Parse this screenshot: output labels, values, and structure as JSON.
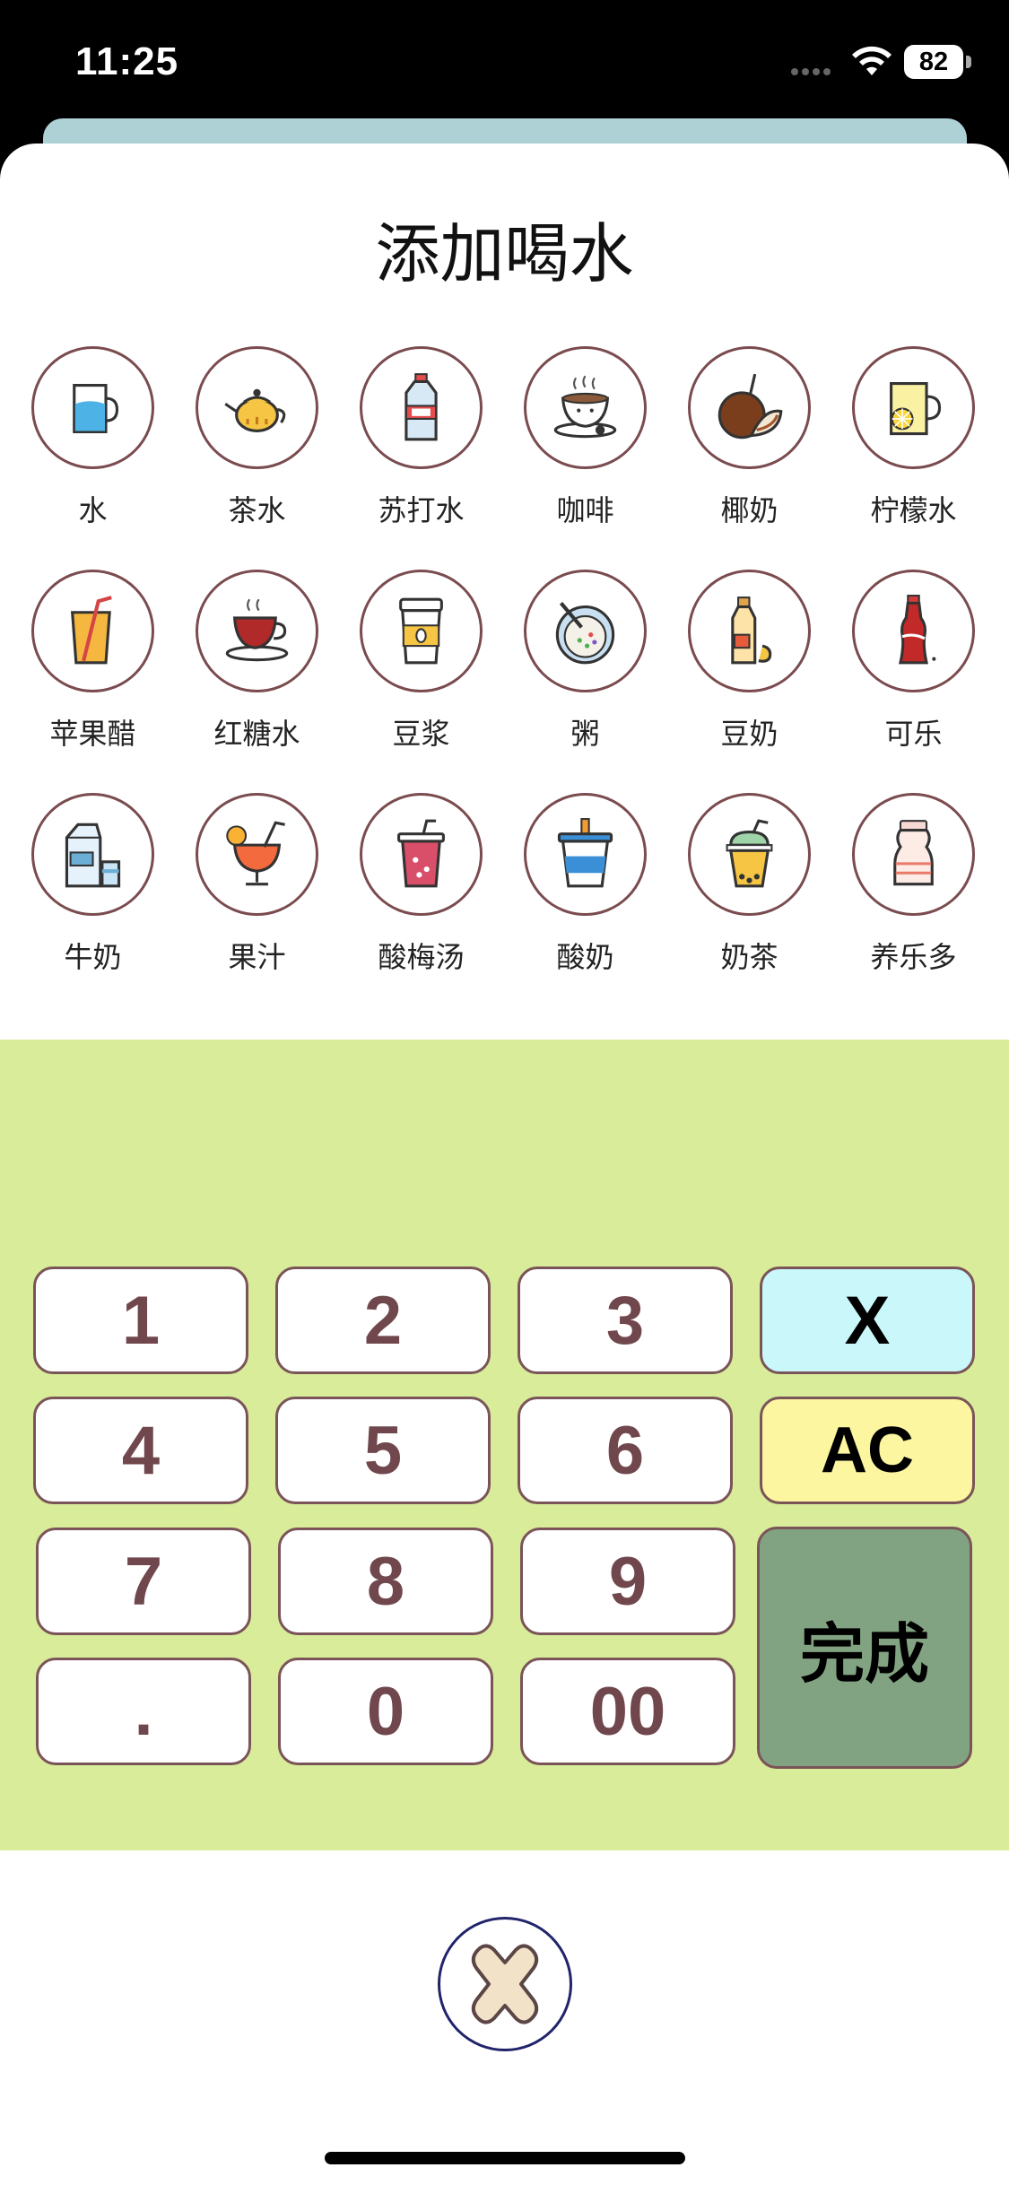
{
  "status_bar": {
    "time": "11:25",
    "battery": "82"
  },
  "sheet": {
    "title": "添加喝水"
  },
  "drinks": [
    {
      "label": "水",
      "icon": "water-glass-icon"
    },
    {
      "label": "茶水",
      "icon": "teapot-icon"
    },
    {
      "label": "苏打水",
      "icon": "soda-bottle-icon"
    },
    {
      "label": "咖啡",
      "icon": "coffee-cup-icon"
    },
    {
      "label": "椰奶",
      "icon": "coconut-icon"
    },
    {
      "label": "柠檬水",
      "icon": "lemonade-icon"
    },
    {
      "label": "苹果醋",
      "icon": "apple-vinegar-icon"
    },
    {
      "label": "红糖水",
      "icon": "brown-sugar-tea-icon"
    },
    {
      "label": "豆浆",
      "icon": "soy-milk-cup-icon"
    },
    {
      "label": "粥",
      "icon": "porridge-bowl-icon"
    },
    {
      "label": "豆奶",
      "icon": "soy-milk-bottle-icon"
    },
    {
      "label": "可乐",
      "icon": "cola-bottle-icon"
    },
    {
      "label": "牛奶",
      "icon": "milk-carton-icon"
    },
    {
      "label": "果汁",
      "icon": "juice-cocktail-icon"
    },
    {
      "label": "酸梅汤",
      "icon": "plum-drink-icon"
    },
    {
      "label": "酸奶",
      "icon": "yogurt-cup-icon"
    },
    {
      "label": "奶茶",
      "icon": "milk-tea-icon"
    },
    {
      "label": "养乐多",
      "icon": "yakult-bottle-icon"
    }
  ],
  "keypad": {
    "keys": [
      "1",
      "2",
      "3",
      "X",
      "4",
      "5",
      "6",
      "AC",
      "7",
      "8",
      "9",
      ".",
      "0",
      "00"
    ],
    "done_label": "完成"
  },
  "colors": {
    "keypad_bg": "#d9ec9a",
    "key_border": "#7a5458",
    "key_text": "#70474c",
    "x_key_bg": "#c9f7fa",
    "ac_key_bg": "#fbf69f",
    "done_key_bg": "#82a382",
    "back_sheet": "#aed1d5"
  },
  "close_icon": "close-x-icon"
}
